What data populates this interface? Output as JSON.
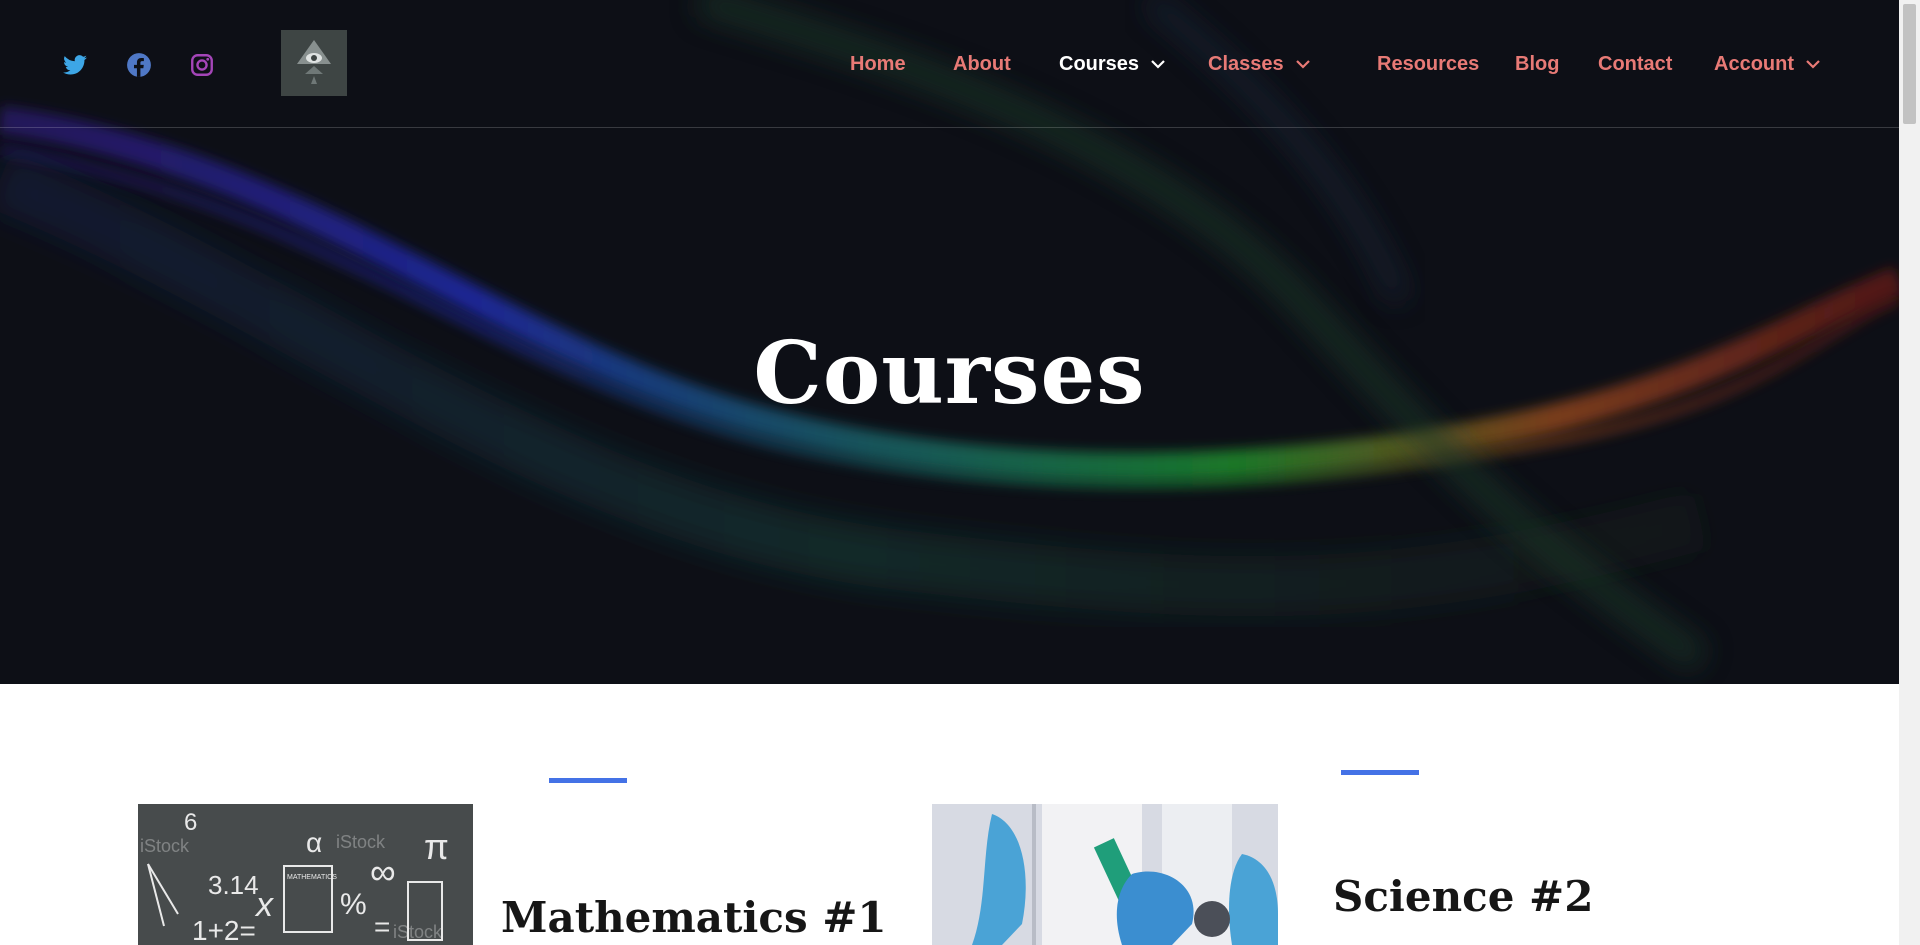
{
  "colors": {
    "hero_bg": "#0d0f16",
    "nav_link": "#e87a76",
    "nav_active": "#ffffff",
    "accent": "#4472e6",
    "twitter": "#3da6e6",
    "facebook": "#4f78c6",
    "instagram": "#a445b8"
  },
  "social": [
    "twitter-icon",
    "facebook-icon",
    "instagram-icon"
  ],
  "nav": {
    "home": "Home",
    "about": "About",
    "courses": "Courses",
    "classes": "Classes",
    "resources": "Resources",
    "blog": "Blog",
    "contact": "Contact",
    "account": "Account"
  },
  "hero": {
    "title": "Courses"
  },
  "cards": [
    {
      "title": "Mathematics #1",
      "image": "math-symbols-chalkboard-image"
    },
    {
      "title": "Science #2",
      "image": "laboratory-scientist-image"
    }
  ],
  "math_image_text": {
    "watermark": "iStock",
    "pi_symbol": "π",
    "alpha_symbol": "α",
    "value_314": "3.14",
    "equation": "1+2=",
    "percent": "%",
    "equals": "=",
    "infinity": "∞",
    "x_symbol": "x",
    "six": "6",
    "book_label": "MATHEMATICS"
  }
}
